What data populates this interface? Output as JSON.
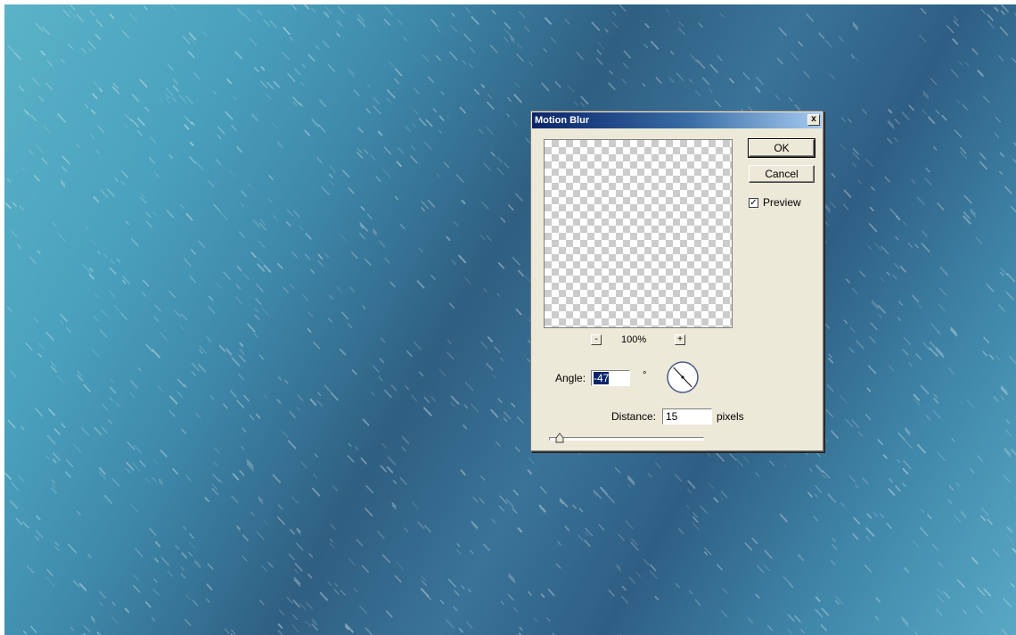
{
  "dialog": {
    "title": "Motion Blur",
    "close_label": "x",
    "ok_label": "OK",
    "cancel_label": "Cancel",
    "preview_label": "Preview",
    "preview_checked": true,
    "zoom": {
      "minus_label": "-",
      "plus_label": "+",
      "level": "100%"
    },
    "angle": {
      "label": "Angle:",
      "value": "-47",
      "unit": "°"
    },
    "distance": {
      "label": "Distance:",
      "value": "15",
      "unit": "pixels",
      "slider_fraction": 0.07
    }
  },
  "colors": {
    "titlebar_start": "#0a246a",
    "titlebar_end": "#a6caf0",
    "dialog_bg": "#ece9d8",
    "selection": "#0a246a"
  }
}
